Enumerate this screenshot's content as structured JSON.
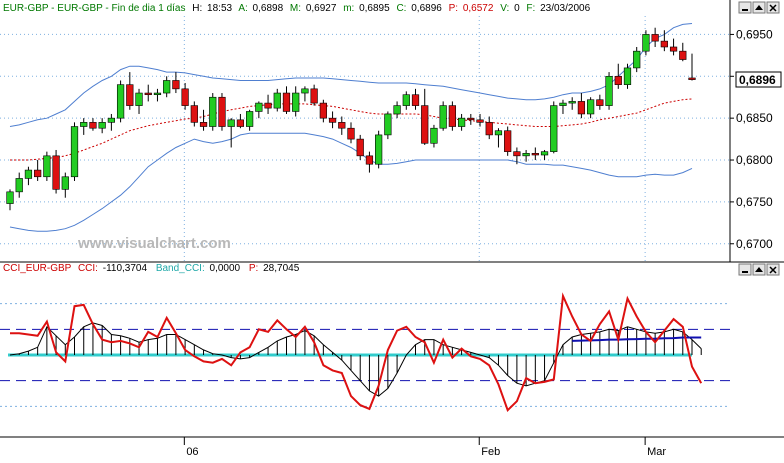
{
  "header": {
    "symbol": "EUR-GBP - EUR-GBP - Fin de dia 1 días",
    "h_label": "H:",
    "h_value": "18:53",
    "a_label": "A:",
    "a_value": "0,6898",
    "m_label": "M:",
    "m_value": "0,6927",
    "mn_label": "m:",
    "mn_value": "0,6895",
    "c_label": "C:",
    "c_value": "0,6896",
    "p_label": "P:",
    "p_value": "0,6572",
    "v_label": "V:",
    "v_value": "0",
    "f_label": "F:",
    "f_value": "23/03/2006"
  },
  "watermark": "www.visualchart.com",
  "last_price": "0,6896",
  "window_buttons": [
    "minimize-icon",
    "restore-icon",
    "close-icon"
  ],
  "cci_header": {
    "title": "CCI_EUR-GBP",
    "cci_label": "CCI:",
    "cci_value": "-110,3704",
    "band_label": "Band_CCI:",
    "band_value": "0,0000",
    "p_label": "P:",
    "p_value": "28,7045"
  },
  "colors": {
    "up_candle": "#22cc22",
    "down_candle": "#dd1111",
    "bollinger": "#4f7fd0",
    "moving_average": "#cc0000",
    "cci_line": "#dd1111",
    "cci_avg": "#000000",
    "band_fill": "#33cccc",
    "band_line": "#1010b0",
    "grid": "#7fb0e0",
    "watermark": "#b8b8b8"
  },
  "chart_data": {
    "type": "candlestick",
    "price_axis": {
      "ticks": [
        "0,6950",
        "0,6900",
        "0,6850",
        "0,6800",
        "0,6750",
        "0,6700"
      ],
      "ylim": [
        0.6683,
        0.6972
      ]
    },
    "x_axis": {
      "ticks": [
        "06",
        "Feb",
        "Mar"
      ]
    },
    "candles": [
      [
        0.6748,
        0.6765,
        0.674,
        0.6762
      ],
      [
        0.6762,
        0.6785,
        0.6755,
        0.6778
      ],
      [
        0.6778,
        0.6792,
        0.677,
        0.6788
      ],
      [
        0.6788,
        0.68,
        0.6775,
        0.678
      ],
      [
        0.678,
        0.681,
        0.6775,
        0.6805
      ],
      [
        0.6805,
        0.6812,
        0.676,
        0.6765
      ],
      [
        0.6765,
        0.6785,
        0.6755,
        0.678
      ],
      [
        0.678,
        0.6845,
        0.6775,
        0.684
      ],
      [
        0.684,
        0.685,
        0.683,
        0.6845
      ],
      [
        0.6845,
        0.685,
        0.6835,
        0.6838
      ],
      [
        0.6838,
        0.685,
        0.6832,
        0.6845
      ],
      [
        0.6845,
        0.6855,
        0.6835,
        0.685
      ],
      [
        0.685,
        0.6895,
        0.6845,
        0.689
      ],
      [
        0.689,
        0.6905,
        0.686,
        0.6865
      ],
      [
        0.6865,
        0.6885,
        0.6855,
        0.688
      ],
      [
        0.688,
        0.689,
        0.687,
        0.6878
      ],
      [
        0.6878,
        0.6885,
        0.687,
        0.688
      ],
      [
        0.688,
        0.69,
        0.6875,
        0.6895
      ],
      [
        0.6895,
        0.6905,
        0.688,
        0.6885
      ],
      [
        0.6885,
        0.6892,
        0.686,
        0.6865
      ],
      [
        0.6865,
        0.687,
        0.684,
        0.6845
      ],
      [
        0.6845,
        0.686,
        0.6835,
        0.684
      ],
      [
        0.684,
        0.688,
        0.6835,
        0.6875
      ],
      [
        0.6875,
        0.688,
        0.6835,
        0.684
      ],
      [
        0.684,
        0.685,
        0.6815,
        0.6848
      ],
      [
        0.6848,
        0.6855,
        0.6838,
        0.684
      ],
      [
        0.684,
        0.686,
        0.6835,
        0.6858
      ],
      [
        0.6858,
        0.687,
        0.685,
        0.6868
      ],
      [
        0.6868,
        0.6878,
        0.6855,
        0.6862
      ],
      [
        0.6862,
        0.6885,
        0.6858,
        0.688
      ],
      [
        0.688,
        0.6888,
        0.6855,
        0.6858
      ],
      [
        0.6858,
        0.6888,
        0.6852,
        0.688
      ],
      [
        0.688,
        0.6888,
        0.687,
        0.6885
      ],
      [
        0.6885,
        0.689,
        0.6865,
        0.6868
      ],
      [
        0.6868,
        0.6872,
        0.6845,
        0.685
      ],
      [
        0.685,
        0.6858,
        0.6838,
        0.6845
      ],
      [
        0.6845,
        0.6852,
        0.683,
        0.6838
      ],
      [
        0.6838,
        0.6845,
        0.682,
        0.6825
      ],
      [
        0.6825,
        0.683,
        0.68,
        0.6805
      ],
      [
        0.6805,
        0.681,
        0.6785,
        0.6795
      ],
      [
        0.6795,
        0.6835,
        0.679,
        0.683
      ],
      [
        0.683,
        0.6858,
        0.6825,
        0.6855
      ],
      [
        0.6855,
        0.687,
        0.685,
        0.6865
      ],
      [
        0.6865,
        0.6882,
        0.686,
        0.6878
      ],
      [
        0.6878,
        0.6885,
        0.686,
        0.6865
      ],
      [
        0.6865,
        0.6885,
        0.6818,
        0.682
      ],
      [
        0.682,
        0.6842,
        0.6815,
        0.6838
      ],
      [
        0.6838,
        0.687,
        0.6835,
        0.6865
      ],
      [
        0.6865,
        0.687,
        0.6835,
        0.684
      ],
      [
        0.684,
        0.6855,
        0.6835,
        0.685
      ],
      [
        0.685,
        0.6855,
        0.6842,
        0.6848
      ],
      [
        0.6848,
        0.6855,
        0.684,
        0.6845
      ],
      [
        0.6845,
        0.6852,
        0.6825,
        0.683
      ],
      [
        0.683,
        0.6838,
        0.6815,
        0.6835
      ],
      [
        0.6835,
        0.684,
        0.6805,
        0.681
      ],
      [
        0.681,
        0.6815,
        0.6795,
        0.6805
      ],
      [
        0.6805,
        0.6812,
        0.6798,
        0.6808
      ],
      [
        0.6808,
        0.6815,
        0.68,
        0.6806
      ],
      [
        0.6806,
        0.6812,
        0.68,
        0.681
      ],
      [
        0.681,
        0.687,
        0.6808,
        0.6865
      ],
      [
        0.6865,
        0.6872,
        0.6855,
        0.6868
      ],
      [
        0.6868,
        0.6875,
        0.686,
        0.687
      ],
      [
        0.687,
        0.688,
        0.685,
        0.6855
      ],
      [
        0.6855,
        0.6875,
        0.685,
        0.6872
      ],
      [
        0.6872,
        0.6878,
        0.686,
        0.6865
      ],
      [
        0.6865,
        0.6905,
        0.686,
        0.69
      ],
      [
        0.69,
        0.6915,
        0.6885,
        0.689
      ],
      [
        0.689,
        0.6915,
        0.6885,
        0.691
      ],
      [
        0.691,
        0.6935,
        0.6905,
        0.693
      ],
      [
        0.693,
        0.6955,
        0.6925,
        0.695
      ],
      [
        0.695,
        0.6958,
        0.6935,
        0.6942
      ],
      [
        0.6942,
        0.6955,
        0.693,
        0.6935
      ],
      [
        0.6935,
        0.6945,
        0.6925,
        0.693
      ],
      [
        0.693,
        0.694,
        0.6918,
        0.692
      ],
      [
        0.6898,
        0.6927,
        0.6895,
        0.6896
      ]
    ],
    "bollinger_upper": [
      0.684,
      0.6842,
      0.6845,
      0.6848,
      0.685,
      0.6855,
      0.686,
      0.687,
      0.688,
      0.6888,
      0.6895,
      0.69,
      0.6908,
      0.6912,
      0.6912,
      0.691,
      0.6908,
      0.6905,
      0.6905,
      0.6904,
      0.6902,
      0.69,
      0.6898,
      0.6897,
      0.6896,
      0.6895,
      0.6895,
      0.6895,
      0.6895,
      0.6896,
      0.6897,
      0.6898,
      0.6898,
      0.6898,
      0.6898,
      0.6897,
      0.6896,
      0.6895,
      0.6894,
      0.6893,
      0.6892,
      0.6892,
      0.6892,
      0.6892,
      0.6891,
      0.689,
      0.6889,
      0.6888,
      0.6886,
      0.6884,
      0.6882,
      0.688,
      0.6878,
      0.6876,
      0.6874,
      0.6873,
      0.6872,
      0.6872,
      0.6873,
      0.6875,
      0.6878,
      0.688,
      0.688,
      0.6882,
      0.6885,
      0.689,
      0.69,
      0.691,
      0.692,
      0.6935,
      0.6945,
      0.695,
      0.6958,
      0.6962,
      0.6963
    ],
    "bollinger_lower": [
      0.672,
      0.6718,
      0.6716,
      0.6715,
      0.6715,
      0.6716,
      0.6718,
      0.6722,
      0.6728,
      0.6735,
      0.6742,
      0.675,
      0.6758,
      0.6768,
      0.678,
      0.6792,
      0.68,
      0.6808,
      0.6815,
      0.682,
      0.6825,
      0.6822,
      0.682,
      0.6822,
      0.6825,
      0.683,
      0.6832,
      0.6832,
      0.6832,
      0.6832,
      0.6832,
      0.6832,
      0.6832,
      0.683,
      0.6828,
      0.6825,
      0.682,
      0.6815,
      0.6808,
      0.68,
      0.6795,
      0.6795,
      0.6796,
      0.6798,
      0.68,
      0.68,
      0.68,
      0.68,
      0.68,
      0.68,
      0.68,
      0.68,
      0.68,
      0.68,
      0.68,
      0.6798,
      0.6795,
      0.6795,
      0.6795,
      0.6794,
      0.6794,
      0.6792,
      0.679,
      0.6788,
      0.6785,
      0.6782,
      0.678,
      0.678,
      0.678,
      0.6782,
      0.6783,
      0.6782,
      0.6782,
      0.6785,
      0.679
    ],
    "moving_average": [
      0.68,
      0.68,
      0.68,
      0.6801,
      0.6802,
      0.6803,
      0.6805,
      0.6808,
      0.6812,
      0.6816,
      0.682,
      0.6825,
      0.683,
      0.6835,
      0.6838,
      0.6841,
      0.6843,
      0.6845,
      0.6847,
      0.6849,
      0.685,
      0.6852,
      0.6855,
      0.6858,
      0.686,
      0.6862,
      0.6864,
      0.6865,
      0.6866,
      0.6867,
      0.6867,
      0.6867,
      0.6867,
      0.6866,
      0.6865,
      0.6864,
      0.6862,
      0.686,
      0.6858,
      0.6856,
      0.6855,
      0.6855,
      0.6855,
      0.6855,
      0.6855,
      0.6854,
      0.6852,
      0.685,
      0.6849,
      0.6848,
      0.6847,
      0.6846,
      0.6845,
      0.6844,
      0.6843,
      0.6842,
      0.6841,
      0.684,
      0.684,
      0.684,
      0.6841,
      0.6842,
      0.6843,
      0.6845,
      0.6848,
      0.685,
      0.6852,
      0.6854,
      0.6856,
      0.686,
      0.6864,
      0.6868,
      0.687,
      0.6872,
      0.6873
    ],
    "cci": {
      "ylim": [
        -300,
        300
      ],
      "levels": {
        "outer": 200,
        "inner": 100,
        "zero": 0
      },
      "cci_line": [
        85,
        85,
        80,
        75,
        130,
        10,
        -25,
        190,
        195,
        120,
        60,
        50,
        55,
        45,
        30,
        90,
        70,
        145,
        85,
        20,
        -5,
        -25,
        -30,
        -15,
        -40,
        10,
        30,
        100,
        90,
        135,
        100,
        70,
        110,
        50,
        -40,
        -60,
        -70,
        -160,
        -195,
        -210,
        -120,
        20,
        95,
        110,
        70,
        50,
        -30,
        60,
        -10,
        25,
        -5,
        -15,
        -40,
        -115,
        -215,
        -180,
        -90,
        -110,
        -105,
        -95,
        230,
        150,
        80,
        55,
        120,
        170,
        60,
        220,
        150,
        90,
        50,
        95,
        140,
        110,
        -45,
        -110
      ],
      "cci_average": [
        0,
        5,
        15,
        30,
        110,
        75,
        40,
        70,
        110,
        125,
        115,
        80,
        75,
        65,
        50,
        60,
        65,
        80,
        80,
        60,
        40,
        20,
        5,
        0,
        -10,
        -15,
        -10,
        10,
        30,
        55,
        70,
        80,
        95,
        75,
        40,
        10,
        -20,
        -60,
        -100,
        -140,
        -160,
        -130,
        -70,
        0,
        40,
        60,
        60,
        40,
        30,
        20,
        10,
        0,
        -10,
        -40,
        -80,
        -110,
        -120,
        -110,
        -100,
        -30,
        40,
        70,
        80,
        85,
        90,
        100,
        95,
        110,
        100,
        90,
        85,
        90,
        100,
        90,
        60,
        25
      ],
      "band_avg": [
        null,
        null,
        null,
        null,
        null,
        null,
        null,
        null,
        null,
        null,
        null,
        null,
        null,
        null,
        null,
        null,
        null,
        null,
        null,
        null,
        null,
        null,
        null,
        null,
        null,
        null,
        null,
        null,
        null,
        null,
        null,
        null,
        null,
        null,
        null,
        null,
        null,
        null,
        null,
        null,
        null,
        null,
        null,
        null,
        null,
        null,
        null,
        null,
        null,
        null,
        null,
        null,
        null,
        null,
        null,
        null,
        null,
        null,
        null,
        null,
        null,
        55,
        56,
        57,
        58,
        60,
        60,
        61,
        62,
        63,
        63,
        65,
        66,
        68,
        68,
        68
      ]
    }
  }
}
